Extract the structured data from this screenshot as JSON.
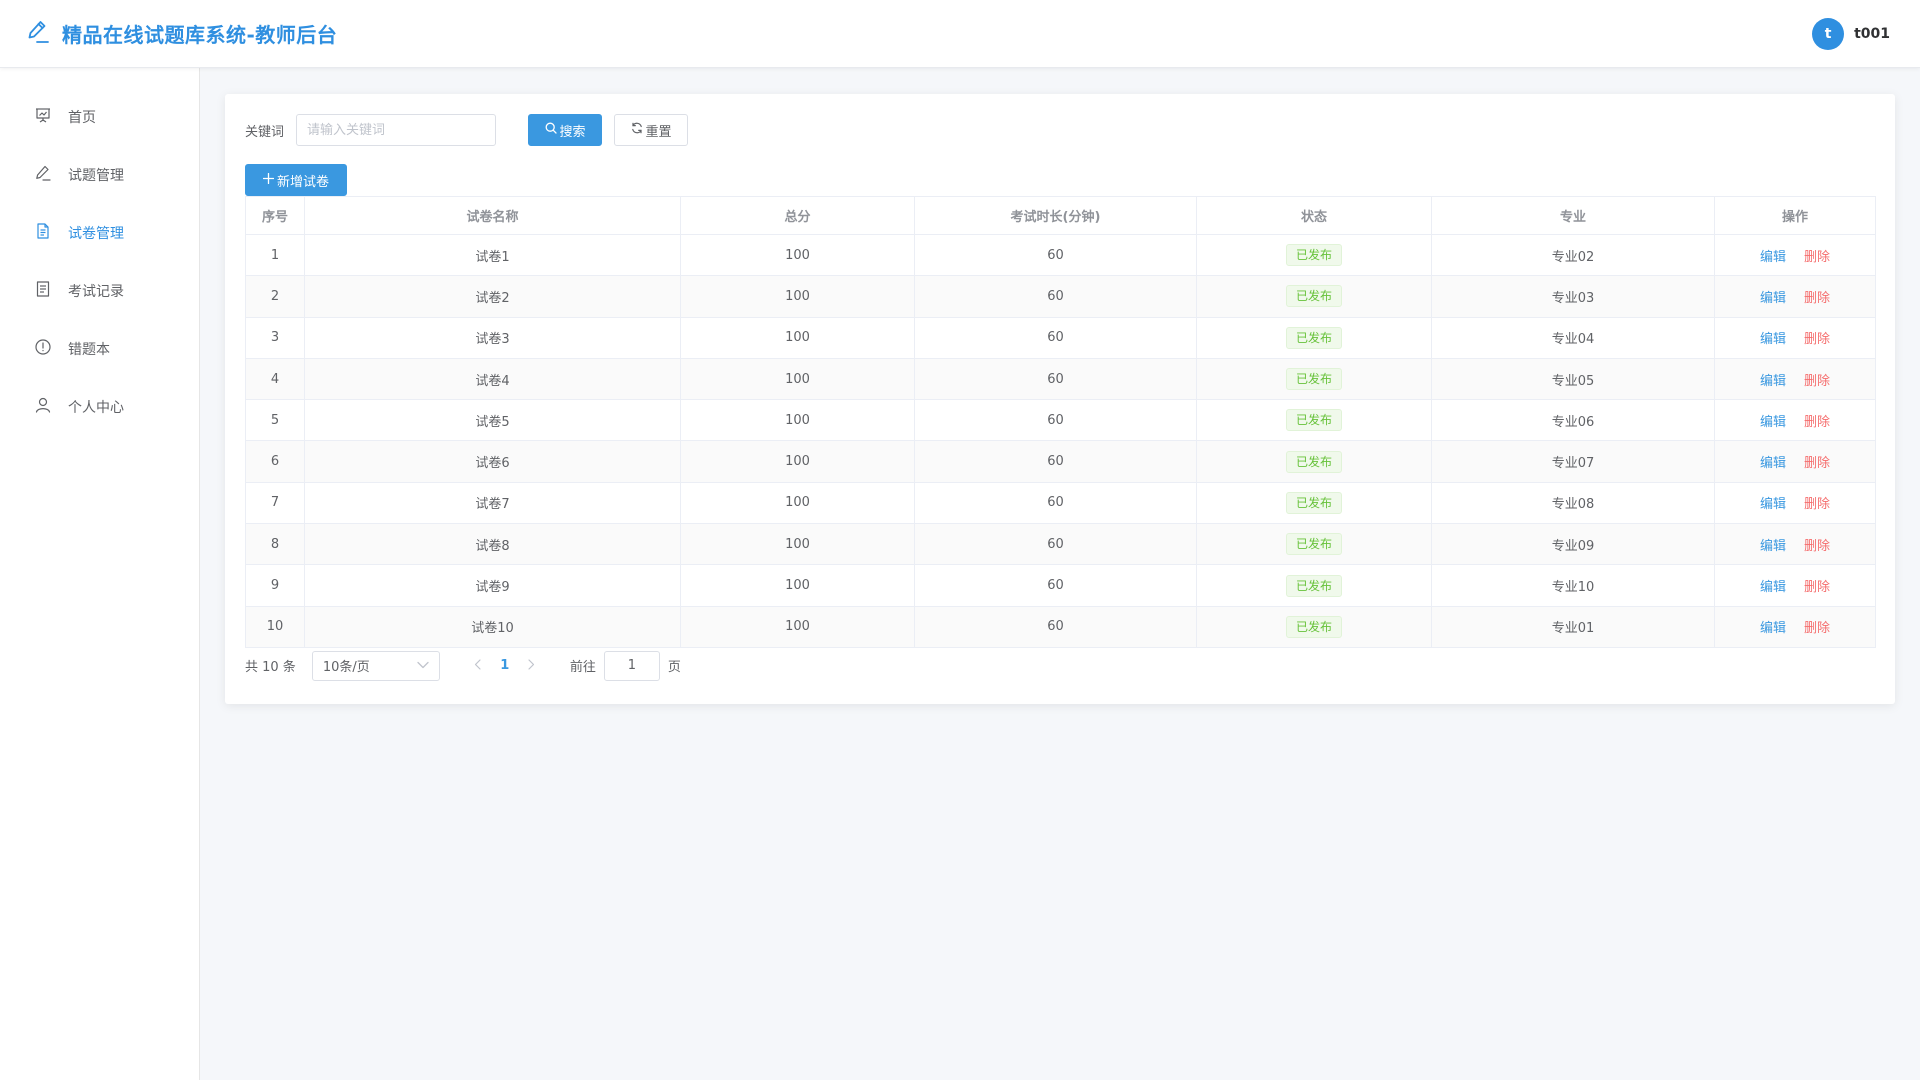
{
  "header": {
    "title": "精品在线试题库系统-教师后台",
    "user": {
      "avatar_letter": "t",
      "name": "t001"
    }
  },
  "sidebar": {
    "items": [
      {
        "label": "首页",
        "icon": "presentation-icon",
        "active": false
      },
      {
        "label": "试题管理",
        "icon": "edit-pen-icon",
        "active": false
      },
      {
        "label": "试卷管理",
        "icon": "document-icon",
        "active": true
      },
      {
        "label": "考试记录",
        "icon": "notebook-icon",
        "active": false
      },
      {
        "label": "错题本",
        "icon": "warning-circle-icon",
        "active": false
      },
      {
        "label": "个人中心",
        "icon": "user-icon",
        "active": false
      }
    ]
  },
  "search": {
    "label": "关键词",
    "placeholder": "请输入关键词",
    "value": "",
    "search_button": "搜索",
    "reset_button": "重置"
  },
  "toolbar": {
    "add_button": "新增试卷"
  },
  "table": {
    "columns": [
      "序号",
      "试卷名称",
      "总分",
      "考试时长(分钟)",
      "状态",
      "专业",
      "操作"
    ],
    "rows": [
      {
        "index": "1",
        "name": "试卷1",
        "score": "100",
        "duration": "60",
        "status": "已发布",
        "major": "专业02"
      },
      {
        "index": "2",
        "name": "试卷2",
        "score": "100",
        "duration": "60",
        "status": "已发布",
        "major": "专业03"
      },
      {
        "index": "3",
        "name": "试卷3",
        "score": "100",
        "duration": "60",
        "status": "已发布",
        "major": "专业04"
      },
      {
        "index": "4",
        "name": "试卷4",
        "score": "100",
        "duration": "60",
        "status": "已发布",
        "major": "专业05"
      },
      {
        "index": "5",
        "name": "试卷5",
        "score": "100",
        "duration": "60",
        "status": "已发布",
        "major": "专业06"
      },
      {
        "index": "6",
        "name": "试卷6",
        "score": "100",
        "duration": "60",
        "status": "已发布",
        "major": "专业07"
      },
      {
        "index": "7",
        "name": "试卷7",
        "score": "100",
        "duration": "60",
        "status": "已发布",
        "major": "专业08"
      },
      {
        "index": "8",
        "name": "试卷8",
        "score": "100",
        "duration": "60",
        "status": "已发布",
        "major": "专业09"
      },
      {
        "index": "9",
        "name": "试卷9",
        "score": "100",
        "duration": "60",
        "status": "已发布",
        "major": "专业10"
      },
      {
        "index": "10",
        "name": "试卷10",
        "score": "100",
        "duration": "60",
        "status": "已发布",
        "major": "专业01"
      }
    ],
    "actions": {
      "edit": "编辑",
      "delete": "删除"
    }
  },
  "pagination": {
    "total_text": "共 10 条",
    "page_size": "10条/页",
    "current_page": "1",
    "goto_label": "前往",
    "goto_value": "1",
    "page_suffix": "页"
  },
  "colors": {
    "primary": "#3a98e0",
    "brand_text": "#2f8fe0",
    "danger": "#f56c6c",
    "success": "#67c23a"
  }
}
